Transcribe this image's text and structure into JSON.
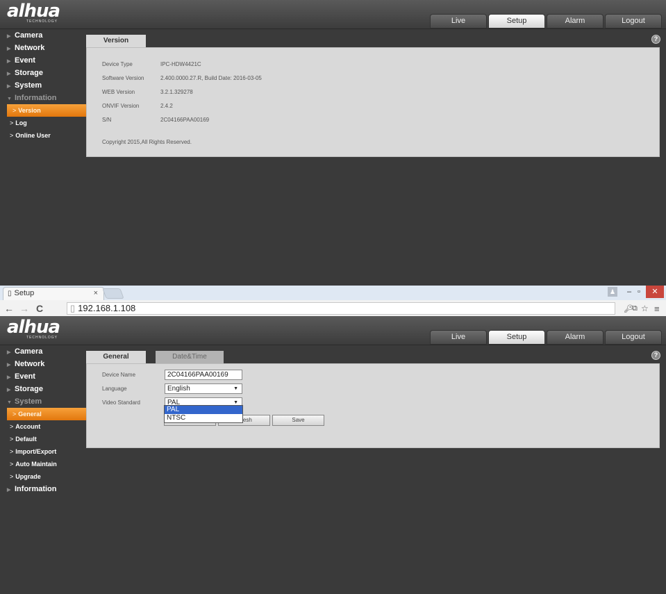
{
  "app": {
    "logo": "alhua",
    "logo_sub": "TECHNOLOGY",
    "nav": [
      "Live",
      "Setup",
      "Alarm",
      "Logout"
    ],
    "help_glyph": "?"
  },
  "top": {
    "sidebar": {
      "items": [
        "Camera",
        "Network",
        "Event",
        "Storage",
        "System"
      ],
      "open_group": "Information",
      "subs": [
        "Version",
        "Log",
        "Online User"
      ]
    },
    "tab": "Version",
    "info": [
      {
        "k": "Device Type",
        "v": "IPC-HDW4421C"
      },
      {
        "k": "Software Version",
        "v": "2.400.0000.27.R, Build Date: 2016-03-05"
      },
      {
        "k": "WEB Version",
        "v": "3.2.1.329278"
      },
      {
        "k": "ONVIF Version",
        "v": "2.4.2"
      },
      {
        "k": "S/N",
        "v": "2C04166PAA00169"
      }
    ],
    "copyright": "Copyright 2015,All Rights Reserved."
  },
  "browser": {
    "tab_title": "Setup",
    "close": "×",
    "url": "192.168.1.108"
  },
  "bottom": {
    "sidebar": {
      "items": [
        "Camera",
        "Network",
        "Event",
        "Storage"
      ],
      "open_group": "System",
      "subs": [
        "General",
        "Account",
        "Default",
        "Import/Export",
        "Auto Maintain",
        "Upgrade"
      ],
      "after": "Information"
    },
    "tabs": [
      "General",
      "Date&Time"
    ],
    "form": {
      "device_name_label": "Device Name",
      "device_name": "2C04166PAA00169",
      "language_label": "Language",
      "language": "English",
      "video_standard_label": "Video Standard",
      "video_standard": "PAL",
      "options": [
        "PAL",
        "NTSC"
      ]
    },
    "buttons": {
      "refresh_partial": "fresh",
      "save": "Save"
    }
  }
}
